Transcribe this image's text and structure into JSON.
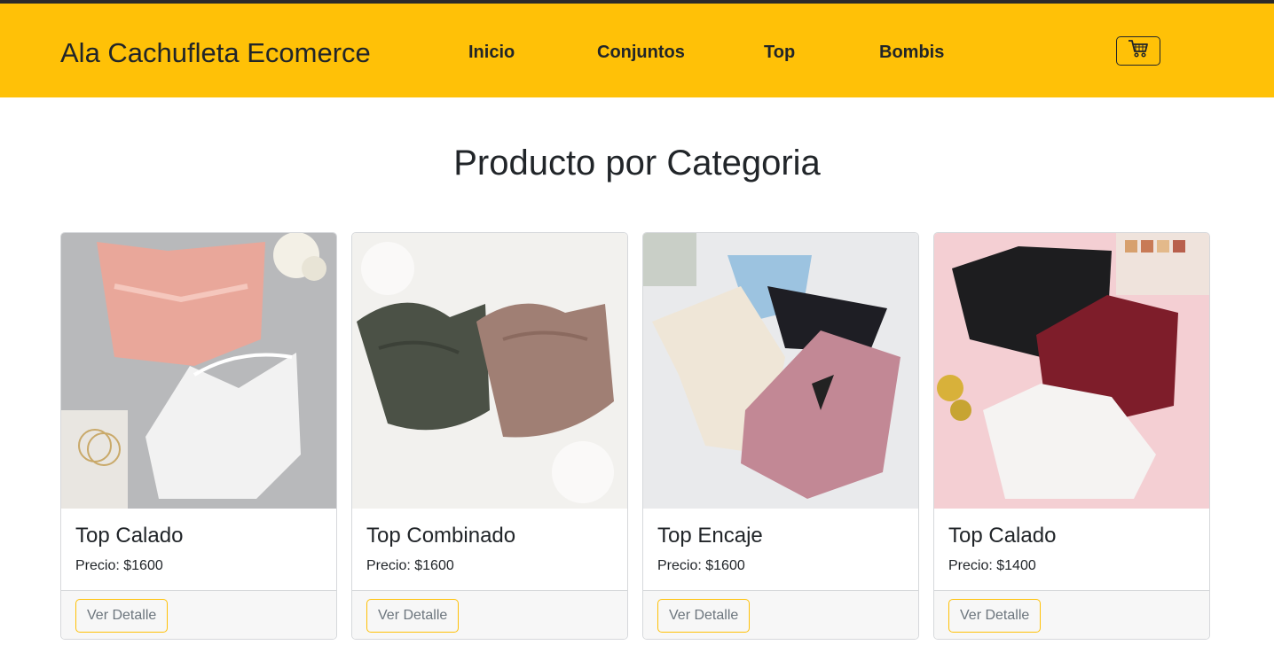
{
  "navbar": {
    "brand": "Ala Cachufleta Ecomerce",
    "links": [
      "Inicio",
      "Conjuntos",
      "Top",
      "Bombis"
    ],
    "cart_icon": "cart-icon"
  },
  "main": {
    "title": "Producto por Categoria"
  },
  "products": [
    {
      "name": "Top Calado",
      "price": "Precio: $1600",
      "button": "Ver Detalle"
    },
    {
      "name": "Top Combinado",
      "price": "Precio: $1600",
      "button": "Ver Detalle"
    },
    {
      "name": "Top Encaje",
      "price": "Precio: $1600",
      "button": "Ver Detalle"
    },
    {
      "name": "Top Calado",
      "price": "Precio: $1400",
      "button": "Ver Detalle"
    }
  ],
  "colors": {
    "navbar": "#ffc107",
    "button_border": "#ffc107",
    "text": "#212529"
  }
}
